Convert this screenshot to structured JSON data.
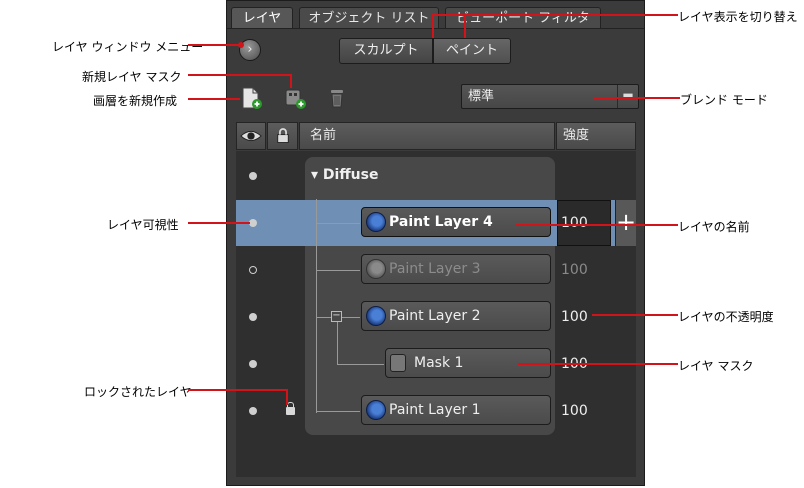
{
  "tabs": [
    {
      "label": "レイヤ"
    },
    {
      "label": "オブジェクト リスト"
    },
    {
      "label": "ビューポート フィルタ"
    }
  ],
  "mode_toggle": {
    "sculpt": "スカルプト",
    "paint": "ペイント"
  },
  "blend_mode": {
    "value": "標準"
  },
  "columns": {
    "name": "名前",
    "strength": "強度"
  },
  "group": {
    "name": "Diffuse"
  },
  "layers": [
    {
      "name": "Paint Layer 4",
      "opacity": "100",
      "visible": true
    },
    {
      "name": "Paint Layer 3",
      "opacity": "100",
      "visible": false
    },
    {
      "name": "Paint Layer 2",
      "opacity": "100",
      "visible": true
    },
    {
      "name": "Mask 1",
      "opacity": "100",
      "visible": true
    },
    {
      "name": "Paint Layer 1",
      "opacity": "100",
      "visible": true,
      "locked": true
    }
  ],
  "annotations": {
    "layer_window_menu": "レイヤ ウィンドウ メニュー",
    "new_layer_mask": "新規レイヤ マスク",
    "create_new_layer": "画層を新規作成",
    "layer_visibility": "レイヤ可視性",
    "locked_layer": "ロックされたレイヤ",
    "switch_layer_display": "レイヤ表示を切り替え",
    "blend_mode": "ブレンド モード",
    "layer_name": "レイヤの名前",
    "layer_opacity": "レイヤの不透明度",
    "layer_mask": "レイヤ マスク"
  },
  "colors": {
    "panel": "#3b3b3b",
    "selection": "#6f8fb4",
    "annotation": "#d0141a"
  }
}
